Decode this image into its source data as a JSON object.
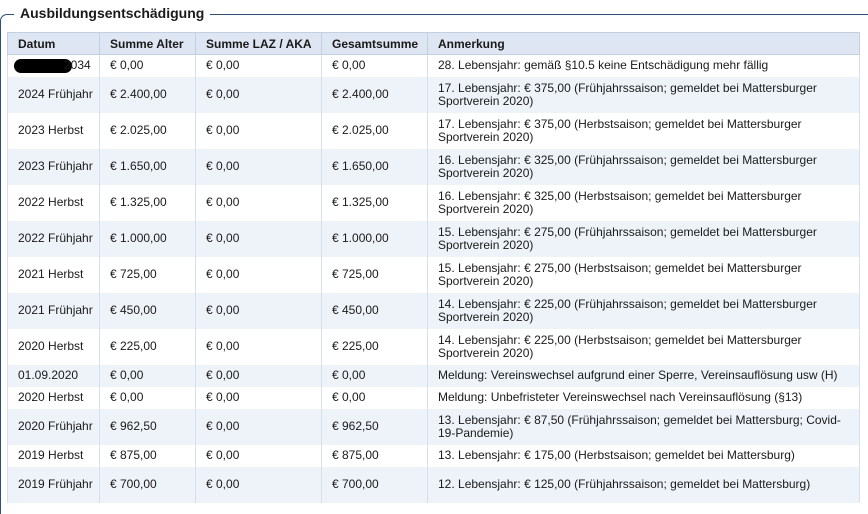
{
  "title": "Ausbildungsentschädigung",
  "headers": [
    "Datum",
    "Summe Alter",
    "Summe LAZ / AKA",
    "Gesamtsumme",
    "Anmerkung"
  ],
  "rows": [
    {
      "datum": "2034",
      "alter": "€ 0,00",
      "laz": "€ 0,00",
      "gesamt": "€ 0,00",
      "anmerkung": "28. Lebensjahr: gemäß §10.5 keine Entschädigung mehr fällig",
      "redacted_prefix": true
    },
    {
      "datum": "2024 Frühjahr",
      "alter": "€ 2.400,00",
      "laz": "€ 0,00",
      "gesamt": "€ 2.400,00",
      "anmerkung": "17. Lebensjahr: € 375,00 (Frühjahrssaison; gemeldet bei Mattersburger Sportverein 2020)"
    },
    {
      "datum": "2023 Herbst",
      "alter": "€ 2.025,00",
      "laz": "€ 0,00",
      "gesamt": "€ 2.025,00",
      "anmerkung": "17. Lebensjahr: € 375,00 (Herbstsaison; gemeldet bei Mattersburger Sportverein 2020)"
    },
    {
      "datum": "2023 Frühjahr",
      "alter": "€ 1.650,00",
      "laz": "€ 0,00",
      "gesamt": "€ 1.650,00",
      "anmerkung": "16. Lebensjahr: € 325,00 (Frühjahrssaison; gemeldet bei Mattersburger Sportverein 2020)"
    },
    {
      "datum": "2022 Herbst",
      "alter": "€ 1.325,00",
      "laz": "€ 0,00",
      "gesamt": "€ 1.325,00",
      "anmerkung": "16. Lebensjahr: € 325,00 (Herbstsaison; gemeldet bei Mattersburger Sportverein 2020)"
    },
    {
      "datum": "2022 Frühjahr",
      "alter": "€ 1.000,00",
      "laz": "€ 0,00",
      "gesamt": "€ 1.000,00",
      "anmerkung": "15. Lebensjahr: € 275,00 (Frühjahrssaison; gemeldet bei Mattersburger Sportverein 2020)"
    },
    {
      "datum": "2021 Herbst",
      "alter": "€ 725,00",
      "laz": "€ 0,00",
      "gesamt": "€ 725,00",
      "anmerkung": "15. Lebensjahr: € 275,00 (Herbstsaison; gemeldet bei Mattersburger Sportverein 2020)"
    },
    {
      "datum": "2021 Frühjahr",
      "alter": "€ 450,00",
      "laz": "€ 0,00",
      "gesamt": "€ 450,00",
      "anmerkung": "14. Lebensjahr: € 225,00 (Frühjahrssaison; gemeldet bei Mattersburger Sportverein 2020)"
    },
    {
      "datum": "2020 Herbst",
      "alter": "€ 225,00",
      "laz": "€ 0,00",
      "gesamt": "€ 225,00",
      "anmerkung": "14. Lebensjahr: € 225,00 (Herbstsaison; gemeldet bei Mattersburger Sportverein 2020)"
    },
    {
      "datum": "01.09.2020",
      "alter": "€ 0,00",
      "laz": "€ 0,00",
      "gesamt": "€ 0,00",
      "anmerkung": "Meldung: Vereinswechsel aufgrund einer Sperre, Vereinsauflösung usw (H)"
    },
    {
      "datum": "2020 Herbst",
      "alter": "€ 0,00",
      "laz": "€ 0,00",
      "gesamt": "€ 0,00",
      "anmerkung": "Meldung: Unbefristeter Vereinswechsel nach Vereinsauflösung (§13)"
    },
    {
      "datum": "2020 Frühjahr",
      "alter": "€ 962,50",
      "laz": "€ 0,00",
      "gesamt": "€ 962,50",
      "anmerkung": "13. Lebensjahr: € 87,50 (Frühjahrssaison; gemeldet bei Mattersburg; Covid-19-Pandemie)"
    },
    {
      "datum": "2019 Herbst",
      "alter": "€ 875,00",
      "laz": "€ 0,00",
      "gesamt": "€ 875,00",
      "anmerkung": "13. Lebensjahr: € 175,00 (Herbstsaison; gemeldet bei Mattersburg)"
    },
    {
      "datum": "2019 Frühjahr",
      "alter": "€ 700,00",
      "laz": "€ 0,00",
      "gesamt": "€ 700,00",
      "anmerkung": "12. Lebensjahr: € 125,00 (Frühjahrssaison; gemeldet bei Mattersburg)"
    }
  ]
}
